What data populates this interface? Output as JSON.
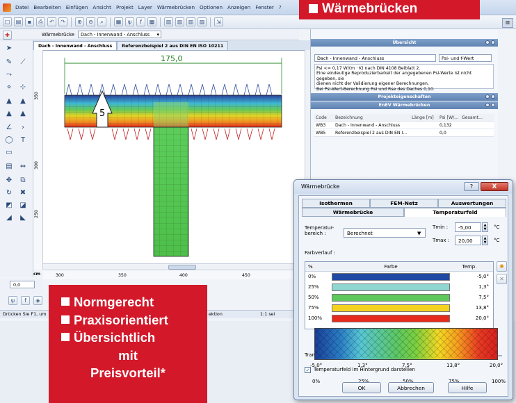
{
  "app": {
    "menu": [
      "Datei",
      "Bearbeiten",
      "Einfügen",
      "Ansicht",
      "Projekt",
      "Layer",
      "Wärmebrücken",
      "Optionen",
      "Anzeigen",
      "Fenster",
      "?"
    ],
    "toolbar2_label": "Wärmebrücke",
    "toolbar2_value": "Dach - Innenwand - Anschluss",
    "doc_tabs": [
      "Dach - Innenwand - Anschluss",
      "Referenzbeispiel 2 aus DIN EN ISO 10211"
    ],
    "dimension": "175,0",
    "marker": "5",
    "ruler_v": [
      "350",
      "300",
      "250"
    ],
    "ruler_h_unit": "cm",
    "ruler_h": [
      "300",
      "350",
      "400",
      "450"
    ],
    "coord_value": "0,0",
    "status_left": "Drücken Sie F1, um",
    "status_mid": "ektion",
    "status_right": "1:1 sel",
    "status_tail": "70"
  },
  "banner": "Wärmebrücken",
  "overview": {
    "header": "Übersicht",
    "field": "Dach - Innenwand - Anschluss",
    "select": "Psi- und f-Wert",
    "text": [
      "Psi <= 0,17 W/(m · K) nach DIN 4108 Beiblatt 2.",
      "Eine eindeutige Reproduzierbarkeit der angegebenen Psi-Werte ist nicht gegeben, sie",
      "dienen nicht der Validierung eigener Berechnungen.",
      "Bei Psi-Wert-Berechnung Rsi und Rse des Daches 0,10."
    ],
    "props_header": "Projekteigenschaften",
    "enev_header": "EnEV Wärmebrücken",
    "table_head": [
      "Code",
      "Bezeichnung",
      "Länge [m]",
      "Psi [W/...",
      "Gesamt..."
    ],
    "rows": [
      [
        "WB3",
        "Dach - Innenwand - Anschluss",
        "",
        "0,132",
        ""
      ],
      [
        "WB5",
        "Referenzbeispiel 2 aus DIN EN I...",
        "",
        "0,0",
        ""
      ]
    ]
  },
  "promo": {
    "items": [
      "Normgerecht",
      "Praxisorientiert",
      "Übersichtlich"
    ],
    "line4": "mit",
    "line5": "Preisvorteil*"
  },
  "dialog": {
    "title": "Wärmebrücke",
    "help": "?",
    "close": "X",
    "tabs_top": [
      "Isothermen",
      "FEM-Netz",
      "Auswertungen"
    ],
    "tabs_bottom": [
      "Wärmebrücke",
      "Temperaturfeld"
    ],
    "range_label": "Temperatur-\nbereich :",
    "range_value": "Berechnet",
    "tmin_label": "Tmin :",
    "tmin": "-5,00",
    "tmax_label": "Tmax :",
    "tmax": "20,00",
    "unit": "°C",
    "farbverlauf": "Farbverlauf :",
    "grid_head": [
      "%",
      "Farbe",
      "Temp."
    ],
    "grid_rows": [
      {
        "pct": "0%",
        "color": "#1f49a3",
        "temp": "-5,0°"
      },
      {
        "pct": "25%",
        "color": "#8fd5d0",
        "temp": "1,3°"
      },
      {
        "pct": "50%",
        "color": "#5ec85a",
        "temp": "7,5°"
      },
      {
        "pct": "75%",
        "color": "#f4d21e",
        "temp": "13,8°"
      },
      {
        "pct": "100%",
        "color": "#e62b1e",
        "temp": "20,0°"
      }
    ],
    "transparency_label": "Transparenz :",
    "transparency_value": "0",
    "transparency_unit": "%",
    "checkbox_label": "Temperaturfeld im Hintergrund darstellen",
    "scale_pct": [
      "0%",
      "25%",
      "50%",
      "75%",
      "100%"
    ],
    "scale_temp": [
      "-5,0°",
      "1,3°",
      "7,5°",
      "13,8°",
      "20,0°"
    ],
    "ok": "OK",
    "cancel": "Abbrechen",
    "help_btn": "Hilfe"
  },
  "colors": {
    "brand_red": "#d3182a"
  }
}
